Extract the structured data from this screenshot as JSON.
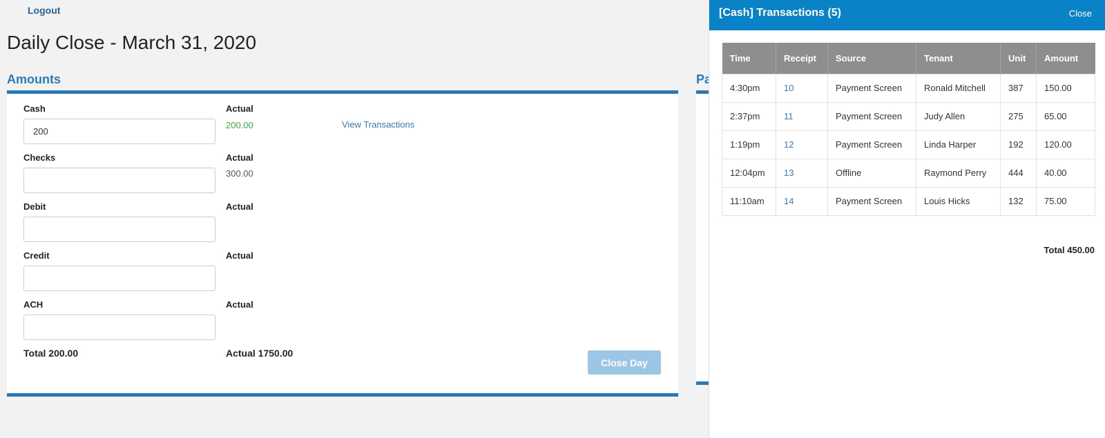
{
  "header": {
    "logout": "Logout",
    "page_title": "Daily Close - March 31, 2020"
  },
  "amounts": {
    "title": "Amounts",
    "fields": [
      {
        "label": "Cash",
        "value": "200",
        "actual_label": "Actual",
        "actual_value": "200.00"
      },
      {
        "label": "Checks",
        "value": "",
        "actual_label": "Actual",
        "actual_value": "300.00"
      },
      {
        "label": "Debit",
        "value": "",
        "actual_label": "Actual",
        "actual_value": ""
      },
      {
        "label": "Credit",
        "value": "",
        "actual_label": "Actual",
        "actual_value": ""
      },
      {
        "label": "ACH",
        "value": "",
        "actual_label": "Actual",
        "actual_value": ""
      }
    ],
    "view_transactions": "View Transactions",
    "total": "Total 200.00",
    "actual_total": "Actual 1750.00",
    "close_day": "Close Day"
  },
  "second_section": {
    "title_partial": "Pa"
  },
  "drawer": {
    "title": "[Cash] Transactions (5)",
    "close": "Close",
    "columns": [
      "Time",
      "Receipt",
      "Source",
      "Tenant",
      "Unit",
      "Amount"
    ],
    "rows": [
      {
        "time": "4:30pm",
        "receipt": "10",
        "source": "Payment Screen",
        "tenant": "Ronald Mitchell",
        "unit": "387",
        "amount": "150.00"
      },
      {
        "time": "2:37pm",
        "receipt": "11",
        "source": "Payment Screen",
        "tenant": "Judy Allen",
        "unit": "275",
        "amount": "65.00"
      },
      {
        "time": "1:19pm",
        "receipt": "12",
        "source": "Payment Screen",
        "tenant": "Linda Harper",
        "unit": "192",
        "amount": "120.00"
      },
      {
        "time": "12:04pm",
        "receipt": "13",
        "source": "Offline",
        "tenant": "Raymond Perry",
        "unit": "444",
        "amount": "40.00"
      },
      {
        "time": "11:10am",
        "receipt": "14",
        "source": "Payment Screen",
        "tenant": "Louis Hicks",
        "unit": "132",
        "amount": "75.00"
      }
    ],
    "total": "Total 450.00"
  },
  "colors": {
    "accent": "#2a77b3",
    "drawer_header": "#0a82c8",
    "actual_green": "#3cae3c",
    "table_header": "#8e8e8e"
  }
}
